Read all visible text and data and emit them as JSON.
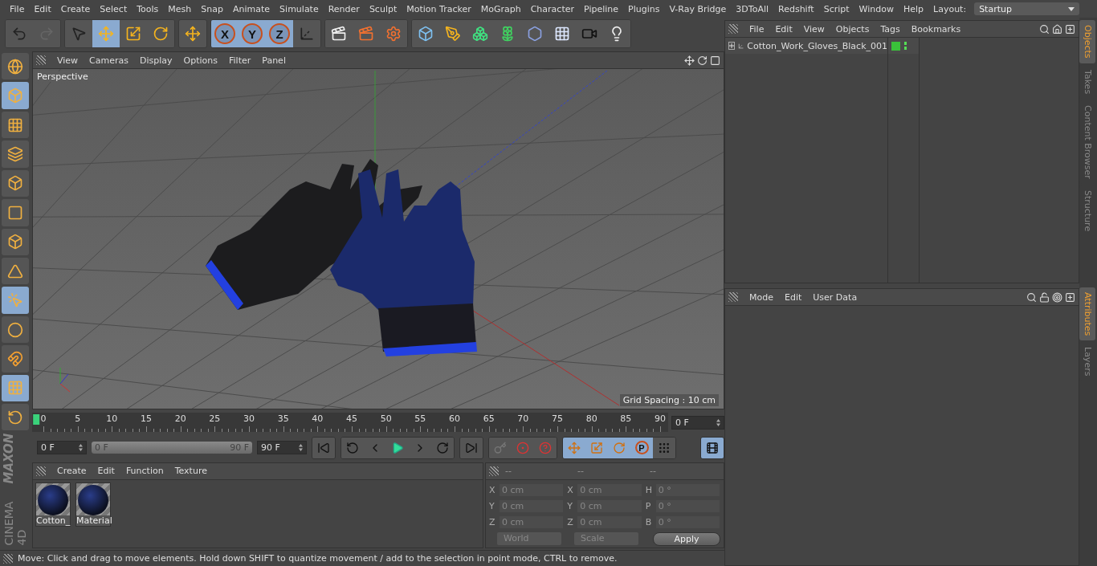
{
  "menu_bar": {
    "items": [
      "File",
      "Edit",
      "Create",
      "Select",
      "Tools",
      "Mesh",
      "Snap",
      "Animate",
      "Simulate",
      "Render",
      "Sculpt",
      "Motion Tracker",
      "MoGraph",
      "Character",
      "Pipeline",
      "Plugins",
      "V-Ray Bridge",
      "3DToAll",
      "Redshift",
      "Script",
      "Window",
      "Help"
    ],
    "layout_label": "Layout:",
    "layout_value": "Startup"
  },
  "toolbar": {
    "groups": [
      {
        "buttons": [
          {
            "selected": false
          },
          {
            "selected": false
          }
        ]
      },
      {
        "buttons": [
          {
            "selected": false
          },
          {
            "selected": true
          },
          {
            "selected": false
          },
          {
            "selected": false
          }
        ]
      },
      {
        "buttons": [
          {
            "selected": false
          }
        ]
      },
      {
        "buttons": [
          {
            "label": "X",
            "selected": true
          },
          {
            "label": "Y",
            "selected": true
          },
          {
            "label": "Z",
            "selected": true
          },
          {
            "selected": false
          }
        ]
      },
      {
        "buttons": [
          {
            "selected": false
          },
          {
            "selected": false
          },
          {
            "selected": false
          }
        ]
      },
      {
        "buttons": [
          {
            "selected": false
          },
          {
            "selected": false
          },
          {
            "selected": false
          },
          {
            "selected": false
          },
          {
            "selected": false
          },
          {
            "selected": false
          },
          {
            "selected": false
          },
          {
            "selected": false
          }
        ]
      }
    ]
  },
  "mode_bar": {
    "buttons": [
      {
        "selected": false
      },
      {
        "selected": true
      },
      {
        "selected": false
      },
      {
        "selected": false
      },
      {
        "selected": false
      },
      {
        "selected": false
      },
      {
        "selected": false
      },
      {
        "selected": false
      },
      {
        "selected": true
      },
      {
        "selected": false
      },
      {
        "selected": false
      },
      {
        "selected": true
      },
      {
        "selected": false
      }
    ]
  },
  "logo": {
    "brand": "MAXON",
    "product": "CINEMA 4D"
  },
  "viewport": {
    "menu": [
      "View",
      "Cameras",
      "Display",
      "Options",
      "Filter",
      "Panel"
    ],
    "camera_label": "Perspective",
    "grid_spacing": "Grid Spacing : 10 cm"
  },
  "timeline": {
    "ticks": [
      "0",
      "5",
      "10",
      "15",
      "20",
      "25",
      "30",
      "35",
      "40",
      "45",
      "50",
      "55",
      "60",
      "65",
      "70",
      "75",
      "80",
      "85",
      "90"
    ],
    "level": 0,
    "current_frame": "0 F"
  },
  "playback": {
    "start": "0 F",
    "range": {
      "start": "0 F",
      "end": "90 F",
      "level": 1
    },
    "end": "90 F",
    "key_buttons": [
      {
        "selected": true
      },
      {
        "selected": true
      },
      {
        "selected": true
      },
      {
        "label": "P",
        "selected": true
      },
      {
        "selected": false
      }
    ]
  },
  "materials": {
    "menu": [
      "Create",
      "Edit",
      "Function",
      "Texture"
    ],
    "items": [
      {
        "name": "Cotton_"
      },
      {
        "name": "Material"
      }
    ]
  },
  "coordinates": {
    "headers": [
      "--",
      "--",
      "--"
    ],
    "columns": [
      {
        "rows": [
          {
            "label": "X",
            "value": "0 cm"
          },
          {
            "label": "Y",
            "value": "0 cm"
          },
          {
            "label": "Z",
            "value": "0 cm"
          }
        ]
      },
      {
        "rows": [
          {
            "label": "X",
            "value": "0 cm"
          },
          {
            "label": "Y",
            "value": "0 cm"
          },
          {
            "label": "Z",
            "value": "0 cm"
          }
        ]
      },
      {
        "rows": [
          {
            "label": "H",
            "value": "0 °"
          },
          {
            "label": "P",
            "value": "0 °"
          },
          {
            "label": "B",
            "value": "0 °"
          }
        ]
      }
    ],
    "dropdowns": [
      "World",
      "Scale"
    ],
    "apply": "Apply"
  },
  "status_bar": "Move: Click and drag to move elements. Hold down SHIFT to quantize movement / add to the selection in point mode, CTRL to remove.",
  "object_manager": {
    "menu": [
      "File",
      "Edit",
      "View",
      "Objects",
      "Tags",
      "Bookmarks"
    ],
    "objects": [
      {
        "name": "Cotton_Work_Gloves_Black_001",
        "expanded": false
      }
    ]
  },
  "attributes": {
    "menu": [
      "Mode",
      "Edit",
      "User Data"
    ]
  },
  "side_tabs": {
    "top": [
      {
        "label": "Objects",
        "selected": true
      },
      {
        "label": "Takes",
        "selected": false
      },
      {
        "label": "Content Browser",
        "selected": false
      },
      {
        "label": "Structure",
        "selected": false
      }
    ],
    "bottom": [
      {
        "label": "Attributes",
        "selected": true
      },
      {
        "label": "Layers",
        "selected": false
      }
    ]
  }
}
